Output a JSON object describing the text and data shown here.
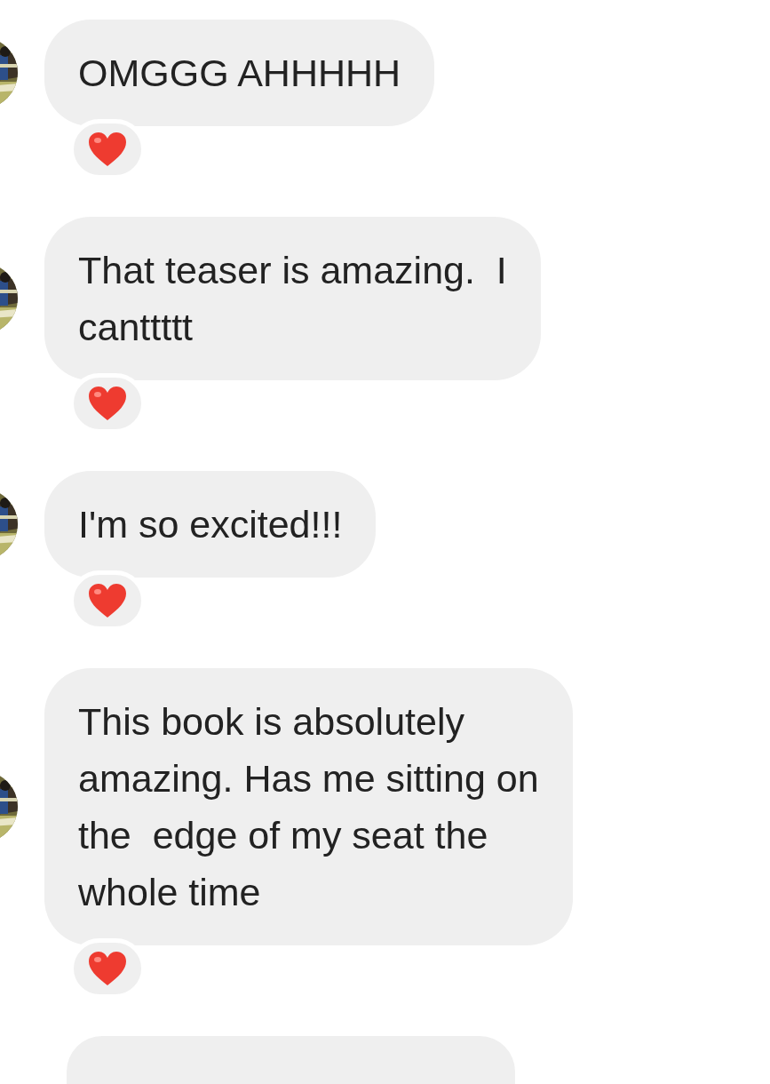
{
  "messages": [
    {
      "lines": [
        "OMGGG AHHHHH"
      ],
      "reacted": true
    },
    {
      "lines": [
        "That teaser is amazing.  I",
        "canttttt"
      ],
      "reacted": true
    },
    {
      "lines": [
        "I'm so excited!!!"
      ],
      "reacted": true
    },
    {
      "lines": [
        "This book is absolutely",
        "amazing. Has me sitting on",
        "the  edge of my seat the",
        "whole time"
      ],
      "reacted": true
    }
  ]
}
